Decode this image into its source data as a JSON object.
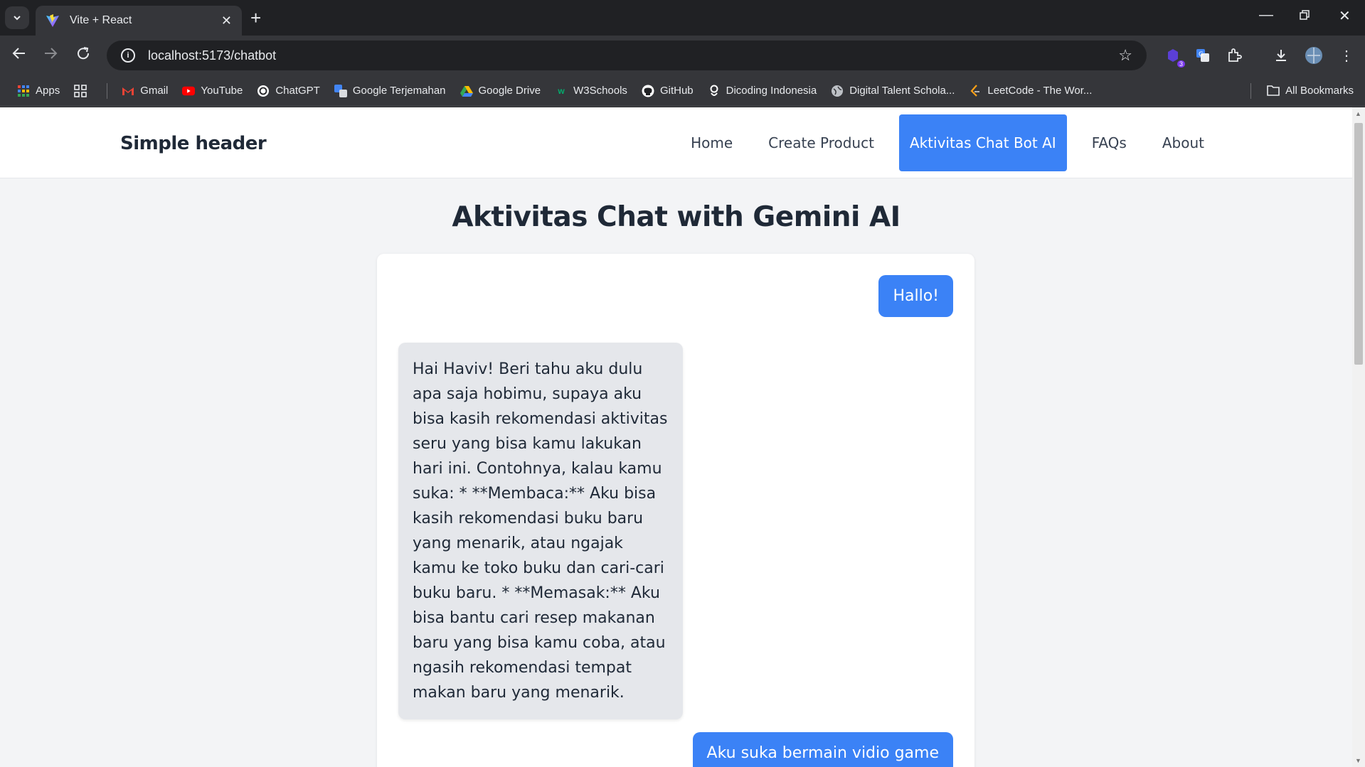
{
  "browser": {
    "tab_title": "Vite + React",
    "url": "localhost:5173/chatbot",
    "extension_badge": "3",
    "bookmarks": [
      {
        "label": "Apps",
        "icon": "apps-grid-icon",
        "color": "#4285f4"
      },
      {
        "label": "Gmail",
        "icon": "gmail-icon",
        "color": "#ea4335"
      },
      {
        "label": "YouTube",
        "icon": "youtube-icon",
        "color": "#ff0000"
      },
      {
        "label": "ChatGPT",
        "icon": "chatgpt-icon",
        "color": "#ffffff"
      },
      {
        "label": "Google Terjemahan",
        "icon": "google-translate-icon",
        "color": "#4285f4"
      },
      {
        "label": "Google Drive",
        "icon": "google-drive-icon",
        "color": "#fbbc04"
      },
      {
        "label": "W3Schools",
        "icon": "w3schools-icon",
        "color": "#04aa6d"
      },
      {
        "label": "GitHub",
        "icon": "github-icon",
        "color": "#ffffff"
      },
      {
        "label": "Dicoding Indonesia",
        "icon": "dicoding-icon",
        "color": "#ffffff"
      },
      {
        "label": "Digital Talent Schola...",
        "icon": "globe-icon",
        "color": "#bdc1c6"
      },
      {
        "label": "LeetCode - The Wor...",
        "icon": "leetcode-icon",
        "color": "#ffa116"
      }
    ],
    "all_bookmarks": "All Bookmarks"
  },
  "site": {
    "brand": "Simple header",
    "nav": [
      "Home",
      "Create Product",
      "Aktivitas Chat Bot AI",
      "FAQs",
      "About"
    ],
    "active_nav": "Aktivitas Chat Bot AI",
    "accent_color": "#3b82f6"
  },
  "page": {
    "title": "Aktivitas Chat with Gemini AI"
  },
  "chat": {
    "messages": [
      {
        "role": "user",
        "text": "Hallo!"
      },
      {
        "role": "bot",
        "text": "Hai Haviv! Beri tahu aku dulu apa saja hobimu, supaya aku bisa kasih rekomendasi aktivitas seru yang bisa kamu lakukan hari ini. Contohnya, kalau kamu suka: * **Membaca:** Aku bisa kasih rekomendasi buku baru yang menarik, atau ngajak kamu ke toko buku dan cari-cari buku baru. * **Memasak:** Aku bisa bantu cari resep makanan baru yang bisa kamu coba, atau ngasih rekomendasi tempat makan baru yang menarik."
      },
      {
        "role": "user",
        "text": "Aku suka bermain vidio game"
      }
    ]
  }
}
